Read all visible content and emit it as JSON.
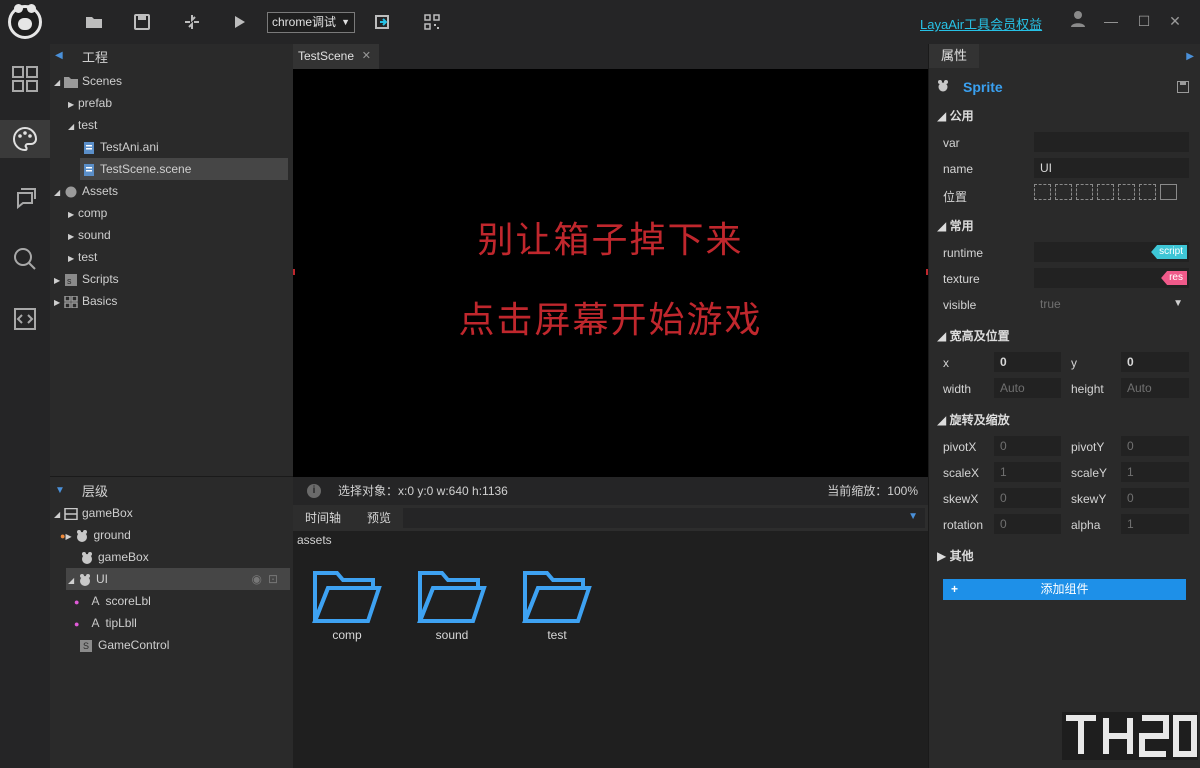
{
  "topbar": {
    "debug_target": "chrome调试",
    "vip_link": "LayaAir工具会员权益"
  },
  "project": {
    "title": "工程",
    "items": [
      {
        "label": "Scenes"
      },
      {
        "label": "prefab"
      },
      {
        "label": "test"
      },
      {
        "label": "TestAni.ani"
      },
      {
        "label": "TestScene.scene"
      },
      {
        "label": "Assets"
      },
      {
        "label": "comp"
      },
      {
        "label": "sound"
      },
      {
        "label": "test"
      },
      {
        "label": "Scripts"
      },
      {
        "label": "Basics"
      }
    ]
  },
  "layers": {
    "title": "层级",
    "items": [
      {
        "label": "gameBox"
      },
      {
        "label": "ground"
      },
      {
        "label": "gameBox"
      },
      {
        "label": "UI"
      },
      {
        "label": "scoreLbl"
      },
      {
        "label": "tipLbll"
      },
      {
        "label": "GameControl"
      }
    ]
  },
  "scene": {
    "tab": "TestScene",
    "line1": "别让箱子掉下来",
    "line2": "点击屏幕开始游戏",
    "selection": "选择对象：x:0 y:0  w:640 h:1136",
    "zoom": "当前缩放：100%"
  },
  "bottom": {
    "tab_timeline": "时间轴",
    "tab_preview": "预览",
    "path": "assets",
    "folders": [
      "comp",
      "sound",
      "test"
    ]
  },
  "props": {
    "title": "属性",
    "component": "Sprite",
    "sec_common": "公用",
    "var_label": "var",
    "var_value": "",
    "name_label": "name",
    "name_value": "UI",
    "pos_label": "位置",
    "sec_frequent": "常用",
    "runtime_label": "runtime",
    "runtime_tag": "script",
    "texture_label": "texture",
    "texture_tag": "res",
    "visible_label": "visible",
    "visible_value": "true",
    "sec_size": "宽高及位置",
    "x_label": "x",
    "x_value": "0",
    "y_label": "y",
    "y_value": "0",
    "width_label": "width",
    "width_value": "Auto",
    "height_label": "height",
    "height_value": "Auto",
    "sec_transform": "旋转及缩放",
    "pivotx_label": "pivotX",
    "pivotx_value": "0",
    "pivoty_label": "pivotY",
    "pivoty_value": "0",
    "scalex_label": "scaleX",
    "scalex_value": "1",
    "scaley_label": "scaleY",
    "scaley_value": "1",
    "skewx_label": "skewX",
    "skewx_value": "0",
    "skewy_label": "skewY",
    "skewy_value": "0",
    "rotation_label": "rotation",
    "rotation_value": "0",
    "alpha_label": "alpha",
    "alpha_value": "1",
    "sec_other": "其他",
    "add_component": "添加组件"
  },
  "colors": {
    "accent": "#1e90e8",
    "link": "#27c2e6",
    "game_text": "#c0272d",
    "script_tag": "#3ec6d6",
    "res_tag": "#f05a8a"
  },
  "icons": [
    "logo-icon",
    "folder-icon",
    "save-icon",
    "refresh-icon",
    "play-icon",
    "export-icon",
    "qrcode-icon",
    "user-icon",
    "minimize-icon",
    "maximize-icon",
    "close-icon",
    "grid-icon",
    "palette-icon",
    "chat-icon",
    "search-icon",
    "code-icon"
  ]
}
